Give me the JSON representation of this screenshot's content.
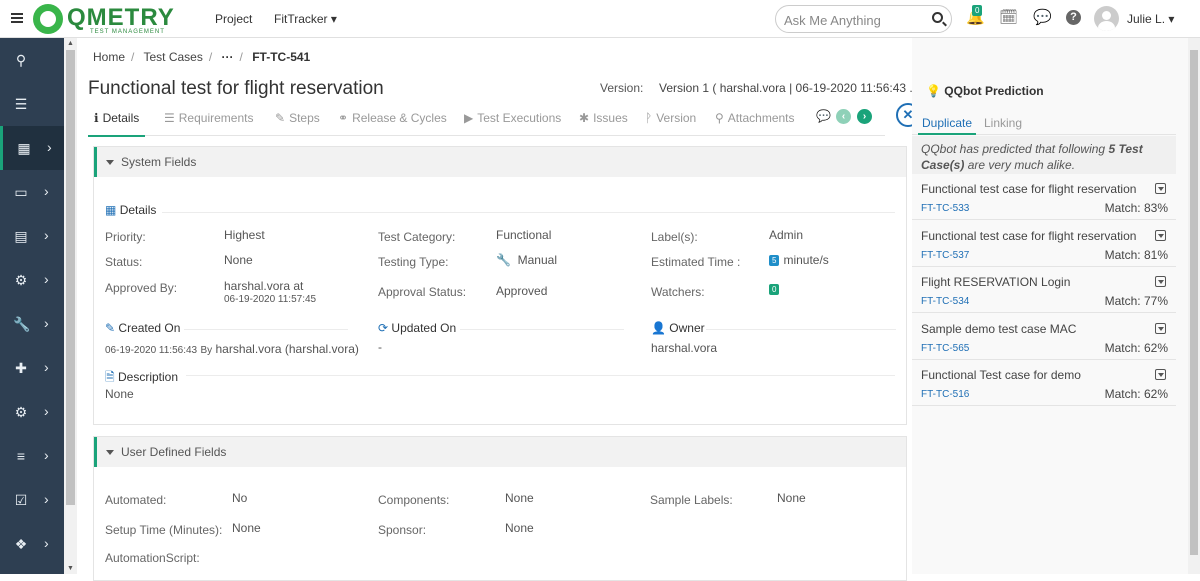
{
  "topbar": {
    "logo_text": "QMETRY",
    "logo_sub": "TEST MANAGEMENT",
    "project_label": "Project",
    "project_name": "FitTracker",
    "search_placeholder": "Ask Me Anything",
    "notification_count": "0",
    "user_name": "Julie L."
  },
  "sidebar": {
    "items": [
      {
        "icon": "search-icon",
        "glyph": "⚲"
      },
      {
        "icon": "list-icon",
        "glyph": "☰"
      },
      {
        "icon": "grid-icon",
        "glyph": "▦",
        "active": true
      },
      {
        "icon": "archive-icon",
        "glyph": "▭"
      },
      {
        "icon": "card-icon",
        "glyph": "▤"
      },
      {
        "icon": "cogs-icon",
        "glyph": "⚙"
      },
      {
        "icon": "wrench-icon",
        "glyph": "🔧"
      },
      {
        "icon": "puzzle-icon",
        "glyph": "✚"
      },
      {
        "icon": "settings-icon",
        "glyph": "⚙"
      },
      {
        "icon": "server-icon",
        "glyph": "≡"
      },
      {
        "icon": "checklist-icon",
        "glyph": "☑"
      },
      {
        "icon": "cubes-icon",
        "glyph": "❖"
      }
    ]
  },
  "breadcrumb": {
    "home": "Home",
    "test_cases": "Test Cases",
    "ellipsis": "···",
    "current": "FT-TC-541"
  },
  "page": {
    "title": "Functional test for flight reservation",
    "version_label": "Version:",
    "version_value": "Version 1 ( harshal.vora | 06-19-2020 11:56:43 ..."
  },
  "tabs": [
    {
      "label": "Details",
      "icon": "info-icon",
      "glyph": "ℹ",
      "active": true
    },
    {
      "label": "Requirements",
      "icon": "list-icon",
      "glyph": "☰"
    },
    {
      "label": "Steps",
      "icon": "edit-icon",
      "glyph": "✎"
    },
    {
      "label": "Release & Cycles",
      "icon": "link-icon",
      "glyph": "⚭"
    },
    {
      "label": "Test Executions",
      "icon": "play-icon",
      "glyph": "▶"
    },
    {
      "label": "Issues",
      "icon": "bug-icon",
      "glyph": "✱"
    },
    {
      "label": "Version",
      "icon": "branch-icon",
      "glyph": "ᚹ"
    },
    {
      "label": "Attachments",
      "icon": "paperclip-icon",
      "glyph": "⚲"
    }
  ],
  "system_fields": {
    "header": "System Fields",
    "details_heading": "Details",
    "priority_label": "Priority:",
    "priority_value": "Highest",
    "status_label": "Status:",
    "status_value": "None",
    "approved_by_label": "Approved By:",
    "approved_by_value": "harshal.vora at",
    "approved_by_date": "06-19-2020 11:57:45",
    "test_category_label": "Test Category:",
    "test_category_value": "Functional",
    "testing_type_label": "Testing Type:",
    "testing_type_value": "Manual",
    "approval_status_label": "Approval Status:",
    "approval_status_value": "Approved",
    "labels_label": "Label(s):",
    "labels_value": "Admin",
    "estimated_time_label": "Estimated Time :",
    "estimated_time_value": "5",
    "estimated_time_unit": "minute/s",
    "watchers_label": "Watchers:",
    "watchers_value": "0",
    "created_on_heading": "Created On",
    "created_on_date": "06-19-2020 11:56:43",
    "created_on_by": "By",
    "created_on_user": "harshal.vora (harshal.vora)",
    "updated_on_heading": "Updated On",
    "updated_on_value": "-",
    "owner_heading": "Owner",
    "owner_value": "harshal.vora",
    "description_heading": "Description",
    "description_value": "None"
  },
  "user_defined_fields": {
    "header": "User Defined Fields",
    "automated_label": "Automated:",
    "automated_value": "No",
    "components_label": "Components:",
    "components_value": "None",
    "sample_labels_label": "Sample Labels:",
    "sample_labels_value": "None",
    "setup_time_label": "Setup Time (Minutes):",
    "setup_time_value": "None",
    "sponsor_label": "Sponsor:",
    "sponsor_value": "None",
    "automation_script_label": "AutomationScript:"
  },
  "qqbot": {
    "title": "QQbot Prediction",
    "tab_duplicate": "Duplicate",
    "tab_linking": "Linking",
    "note_prefix": "QQbot has predicted that following ",
    "note_bold": "5 Test Case(s)",
    "note_suffix": " are very much alike.",
    "items": [
      {
        "name": "Functional test case for flight reservation",
        "id": "FT-TC-533",
        "match": "Match: 83%"
      },
      {
        "name": "Functional test case for flight reservation",
        "id": "FT-TC-537",
        "match": "Match: 81%"
      },
      {
        "name": "Flight RESERVATION Login",
        "id": "FT-TC-534",
        "match": "Match: 77%"
      },
      {
        "name": "Sample demo test case MAC",
        "id": "FT-TC-565",
        "match": "Match: 62%"
      },
      {
        "name": "Functional Test case for demo",
        "id": "FT-TC-516",
        "match": "Match: 62%"
      }
    ]
  },
  "colors": {
    "accent": "#1aa37a",
    "link": "#1f6fb5",
    "sidebar": "#2e3f52"
  }
}
